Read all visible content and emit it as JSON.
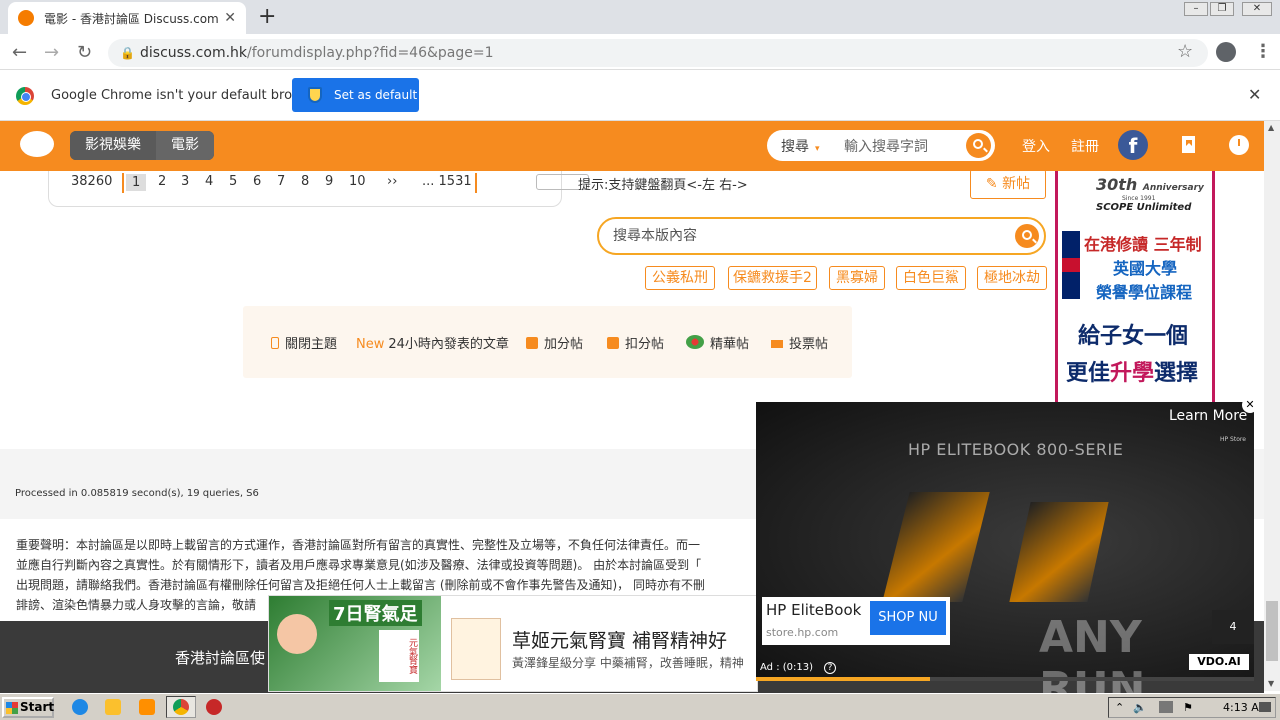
{
  "browser": {
    "tab_title": "電影 - 香港討論區 Discuss.com.hk -",
    "url_host": "discuss.com.hk",
    "url_path": "/forumdisplay.php?fid=46&page=1",
    "infobar_text": "Google Chrome isn't your default browser",
    "set_default_label": "Set as default"
  },
  "header": {
    "categories": [
      "影視娛樂",
      "電影"
    ],
    "search_select": "搜尋",
    "search_placeholder": "輸入搜尋字詞",
    "login": "登入",
    "register": "註冊"
  },
  "pagination": {
    "total": "38260",
    "pages": [
      "1",
      "2",
      "3",
      "4",
      "5",
      "6",
      "7",
      "8",
      "9",
      "10",
      "››",
      "... 1531"
    ]
  },
  "hint": "提示:支持鍵盤翻頁<-左 右->",
  "new_post": "新帖",
  "board_search_placeholder": "搜尋本版內容",
  "tags": [
    "公義私刑",
    "保鑣救援手2",
    "黑寡婦",
    "白色巨鯊",
    "極地冰劫"
  ],
  "filters": {
    "closed": "關閉主題",
    "new_badge": "New",
    "recent": "24小時內發表的文章",
    "plus": "加分帖",
    "minus": "扣分帖",
    "digest": "精華帖",
    "poll": "投票帖"
  },
  "side_ad": {
    "years": "30th",
    "anniversary": "Anniversary",
    "since": "Since 1991",
    "brand": "SCOPE Unlimited",
    "line1": "在港修讀 三年制",
    "line2": "英國大學",
    "line3": "榮譽學位課程",
    "line4": "給子女一個",
    "line5a": "更佳",
    "line5b": "升學",
    "line5c": "選擇"
  },
  "processed": "Processed in 0.085819 second(s), 19 queries, S6",
  "disclaimer": [
    "重要聲明：本討論區是以即時上載留言的方式運作，香港討論區對所有留言的真實性、完整性及立場等，不負任何法律責任。而一",
    "並應自行判斷內容之真實性。於有關情形下，讀者及用戶應尋求專業意見(如涉及醫療、法律或投資等問題)。 由於本討論區受到「",
    "出現問題，請聯絡我們。香港討論區有權刪除任何留言及拒絕任何人士上載留言 (刪除前或不會作事先警告及通知)， 同時亦有不刪",
    "誹謗、渲染色情暴力或人身攻擊的言論，敬請"
  ],
  "footer_text": "香港討論區使",
  "bottom_ad": {
    "headline": "草姬元氣腎寶 補腎精神好",
    "sub": "黃澤鋒星級分享 中藥補腎，改善睡眠，精神",
    "badge": "7日腎氣足",
    "product": "元氣腎寶"
  },
  "video_ad": {
    "learn_more": "Learn More",
    "hp_store": "HP Store",
    "banner": "HP ELITEBOOK 800-SERIE",
    "title": "HP EliteBook",
    "domain": "store.hp.com",
    "cta": "SHOP NU",
    "timer": "Ad : (0:13)",
    "count": "4",
    "vdo": "VDO.AI",
    "progress": 0.35
  },
  "watermark": "ANY RUN",
  "taskbar": {
    "start": "Start",
    "time": "4:13 AM"
  }
}
